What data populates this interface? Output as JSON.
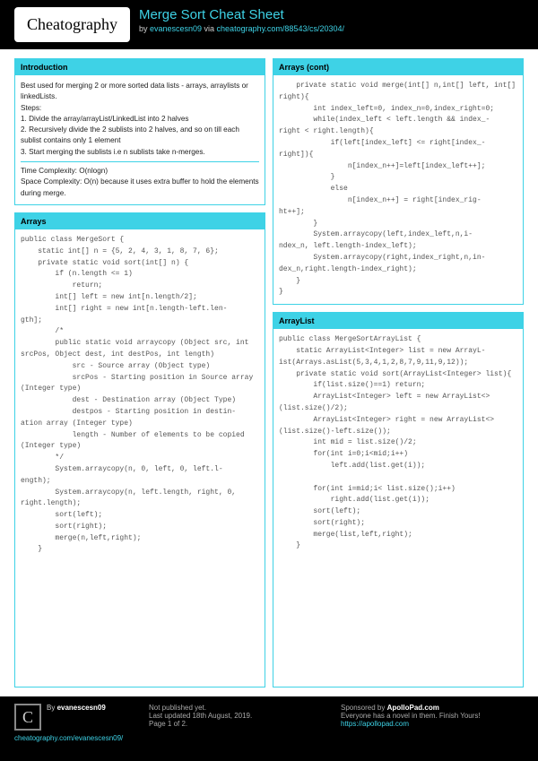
{
  "logo": "Cheatography",
  "title": "Merge Sort Cheat Sheet",
  "byline_by": "by ",
  "author": "evanescesn09",
  "byline_via": " via ",
  "cheat_url": "cheatography.com/88543/cs/20304/",
  "sections": {
    "intro_header": "Introduction",
    "intro_p1": "Best used for merging 2 or more sorted data lists - arrays, arraylists or linkedLists.",
    "intro_p2": "Steps:",
    "intro_s1": "1. Divide the array/arrayList/LinkedList into 2 halves",
    "intro_s2": "2. Recursively divide the 2 sublists into 2 halves, and so on till each sublist contains only 1 element",
    "intro_s3": "3. Start merging the sublists i.e n sublists take n-merges.",
    "intro_tc": "Time Complexity: O(nlogn)",
    "intro_sc": "Space Complexity: O(n) because it uses extra buffer to hold the elements during merge.",
    "arrays_header": "Arrays",
    "arrays_code": "public class MergeSort {\n    static int[] n = {5, 2, 4, 3, 1, 8, 7, 6};\n    private static void sort(int[] n) {\n        if (n.length <= 1)\n            return;\n        int[] left = new int[n.length/2];\n        int[] right = new int[n.length-left.len-\ngth];\n        /*\n        public static void arraycopy (Object src, int srcPos, Object dest, int destPos, int length)\n            src - Source array (Object type)\n            srcPos - Starting position in Source array (Integer type)\n            dest - Destination array (Object Type)\n            destpos - Starting position in destin-\nation array (Integer type)\n            length - Number of elements to be copied (Integer type)\n        */\n        System.arraycopy(n, 0, left, 0, left.l-\nength);\n        System.arraycopy(n, left.length, right, 0, right.length);\n        sort(left);\n        sort(right);\n        merge(n,left,right);\n    }",
    "arrays_cont_header": "Arrays (cont)",
    "arrays_cont_code": "    private static void merge(int[] n,int[] left, int[] right){\n        int index_left=0, index_n=0,index_right=0;\n        while(index_left < left.length && index_-\nright < right.length){\n            if(left[index_left] <= right[index_-\nright]){\n                n[index_n++]=left[index_left++];\n            }\n            else\n                n[index_n++] = right[index_rig-\nht++];\n        }\n        System.arraycopy(left,index_left,n,i-\nndex_n, left.length-index_left);\n        System.arraycopy(right,index_right,n,in-\ndex_n,right.length-index_right);\n    }\n}",
    "arraylist_header": "ArrayList",
    "arraylist_code": "public class MergeSortArrayList {\n    static ArrayList<Integer> list = new ArrayL-\nist(Arrays.asList(5,3,4,1,2,8,7,9,11,9,12));\n    private static void sort(ArrayList<Integer> list){\n        if(list.size()==1) return;\n        ArrayList<Integer> left = new ArrayList<>\n(list.size()/2);\n        ArrayList<Integer> right = new ArrayList<>\n(list.size()-left.size());\n        int mid = list.size()/2;\n        for(int i=0;i<mid;i++)\n            left.add(list.get(i));\n\n        for(int i=mid;i< list.size();i++)\n            right.add(list.get(i));\n        sort(left);\n        sort(right);\n        merge(list,left,right);\n    }"
  },
  "footer": {
    "by_label": "By ",
    "author": "evanescesn09",
    "author_url": "cheatography.com/evanescesn09/",
    "not_published": "Not published yet.",
    "last_updated": "Last updated 18th August, 2019.",
    "page": "Page 1 of 2.",
    "sponsored_by": "Sponsored by ",
    "sponsor": "ApolloPad.com",
    "sponsor_tag": "Everyone has a novel in them. Finish Yours!",
    "sponsor_url": "https://apollopad.com"
  }
}
